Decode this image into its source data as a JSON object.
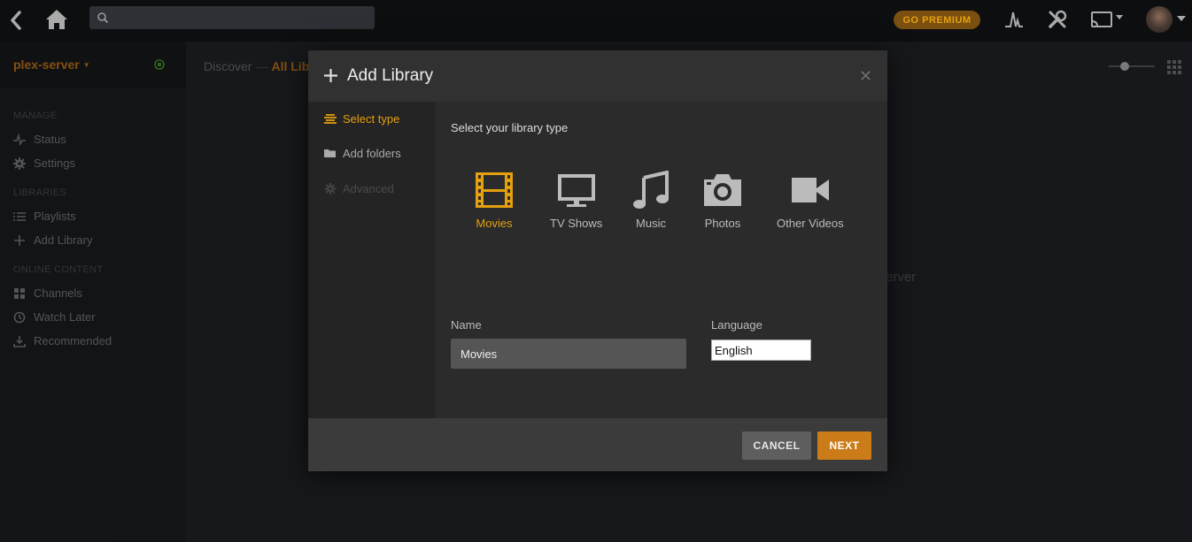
{
  "colors": {
    "accent": "#cc7b19",
    "accent_bright": "#e5a00d",
    "premium_bg": "#7a4f10",
    "status_green": "#4f9a2c"
  },
  "topbar": {
    "search_placeholder": "",
    "premium_label": "GO PREMIUM",
    "icons": [
      "back-icon",
      "home-icon",
      "search-icon",
      "activity-icon",
      "settings-tools-icon",
      "cast-icon",
      "avatar"
    ]
  },
  "sidebar": {
    "server_name": "plex-server",
    "sections": {
      "manage": "MANAGE",
      "libraries": "LIBRARIES",
      "online": "ONLINE CONTENT"
    },
    "items": {
      "status": "Status",
      "settings": "Settings",
      "playlists": "Playlists",
      "add_library": "Add Library",
      "channels": "Channels",
      "watch_later": "Watch Later",
      "recommended": "Recommended"
    }
  },
  "breadcrumb": {
    "discover": "Discover",
    "sep": "—",
    "current": "All Lib"
  },
  "background_text": "erver",
  "modal": {
    "title": "Add Library",
    "nav": {
      "select_type": "Select type",
      "add_folders": "Add folders",
      "advanced": "Advanced"
    },
    "body_label": "Select your library type",
    "types": {
      "movies": "Movies",
      "tv_shows": "TV Shows",
      "music": "Music",
      "photos": "Photos",
      "other_videos": "Other Videos"
    },
    "selected_type": "Movies",
    "name_label": "Name",
    "name_value": "Movies",
    "language_label": "Language",
    "language_value": "English",
    "cancel": "CANCEL",
    "next": "NEXT"
  }
}
